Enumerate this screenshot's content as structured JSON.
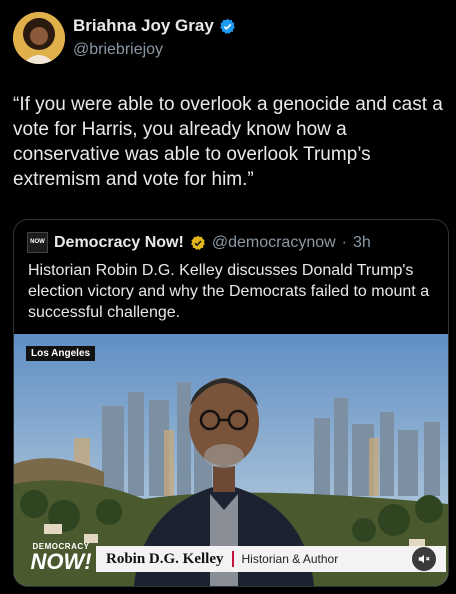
{
  "author": {
    "display_name": "Briahna Joy Gray",
    "handle": "@briebriejoy",
    "verified_color": "#1d9bf0"
  },
  "tweet": {
    "text": "“If you were able to overlook a genocide and cast a vote for Harris, you already know how a conservative was able to overlook Trump’s extremism and vote for him.”"
  },
  "quote": {
    "logo_text": "NOW",
    "display_name": "Democracy Now!",
    "handle": "@democracynow",
    "separator": "·",
    "time": "3h",
    "verified_color": "#e2b719",
    "text": "Historian Robin D.G. Kelley discusses Donald Trump's election victory and why the Democrats failed to mount a successful challenge.",
    "video": {
      "location_tag": "Los Angeles",
      "bug_small": "DEMOCRACY",
      "bug_big": "NOW!",
      "person_name": "Robin D.G. Kelley",
      "person_role": "Historian & Author",
      "mute_icon": "speaker-muted-icon",
      "accent_color": "#c0143c"
    }
  }
}
